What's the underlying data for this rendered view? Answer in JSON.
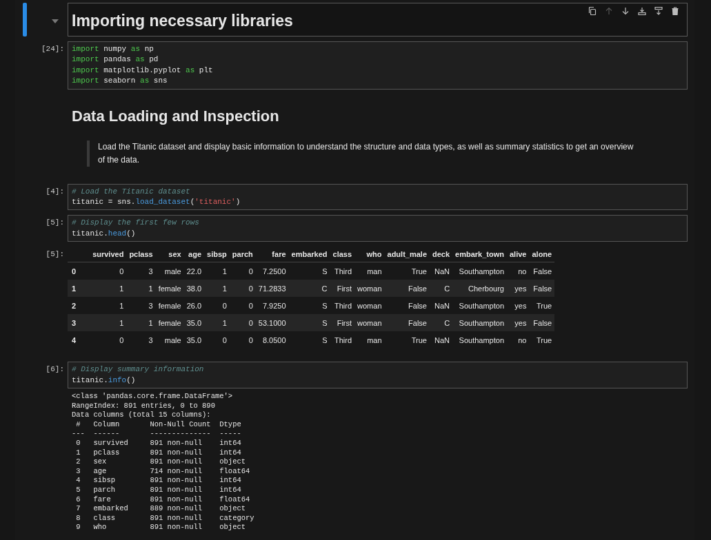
{
  "cells": [
    {
      "kind": "title",
      "active": true,
      "text": "Importing necessary libraries",
      "toolbar": [
        {
          "disabled": false
        },
        {
          "disabled": true
        },
        {
          "disabled": false
        },
        {
          "disabled": false
        },
        {
          "disabled": false
        },
        {
          "disabled": false
        }
      ]
    },
    {
      "kind": "code",
      "prompt": "[24]:",
      "lines": [
        [
          {
            "kind": "keyword",
            "text": "import"
          },
          {
            "kind": "plain",
            "text": " numpy "
          },
          {
            "kind": "keyword",
            "text": "as"
          },
          {
            "kind": "plain",
            "text": " np"
          }
        ],
        [
          {
            "kind": "keyword",
            "text": "import"
          },
          {
            "kind": "plain",
            "text": " pandas "
          },
          {
            "kind": "keyword",
            "text": "as"
          },
          {
            "kind": "plain",
            "text": " pd"
          }
        ],
        [
          {
            "kind": "keyword",
            "text": "import"
          },
          {
            "kind": "plain",
            "text": " matplotlib.pyplot "
          },
          {
            "kind": "keyword",
            "text": "as"
          },
          {
            "kind": "plain",
            "text": " plt"
          }
        ],
        [
          {
            "kind": "keyword",
            "text": "import"
          },
          {
            "kind": "plain",
            "text": " seaborn "
          },
          {
            "kind": "keyword",
            "text": "as"
          },
          {
            "kind": "plain",
            "text": " sns"
          }
        ]
      ]
    },
    {
      "kind": "section",
      "text": "Data Loading and Inspection",
      "quote": "Load the Titanic dataset and display basic information to understand the structure and data types, as well as summary statistics to get an overview of the data."
    },
    {
      "kind": "code",
      "prompt": "[4]:",
      "lines": [
        [
          {
            "kind": "comment",
            "text": "# Load the Titanic dataset"
          }
        ],
        [
          {
            "kind": "plain",
            "text": "titanic = sns."
          },
          {
            "kind": "function",
            "text": "load_dataset"
          },
          {
            "kind": "plain",
            "text": "("
          },
          {
            "kind": "string",
            "text": "'titanic'"
          },
          {
            "kind": "plain",
            "text": ")"
          }
        ]
      ]
    },
    {
      "kind": "code",
      "prompt": "[5]:",
      "lines": [
        [
          {
            "kind": "comment",
            "text": "# Display the first few rows"
          }
        ],
        [
          {
            "kind": "plain",
            "text": "titanic."
          },
          {
            "kind": "function",
            "text": "head"
          },
          {
            "kind": "plain",
            "text": "()"
          }
        ]
      ],
      "output": {
        "kind": "table",
        "prompt": "[5]:",
        "columns": [
          "survived",
          "pclass",
          "sex",
          "age",
          "sibsp",
          "parch",
          "fare",
          "embarked",
          "class",
          "who",
          "adult_male",
          "deck",
          "embark_town",
          "alive",
          "alone"
        ],
        "rows": [
          {
            "index": "0",
            "cells": [
              "0",
              "3",
              "male",
              "22.0",
              "1",
              "0",
              "7.2500",
              "S",
              "Third",
              "man",
              "True",
              "NaN",
              "Southampton",
              "no",
              "False"
            ]
          },
          {
            "index": "1",
            "cells": [
              "1",
              "1",
              "female",
              "38.0",
              "1",
              "0",
              "71.2833",
              "C",
              "First",
              "woman",
              "False",
              "C",
              "Cherbourg",
              "yes",
              "False"
            ]
          },
          {
            "index": "2",
            "cells": [
              "1",
              "3",
              "female",
              "26.0",
              "0",
              "0",
              "7.9250",
              "S",
              "Third",
              "woman",
              "False",
              "NaN",
              "Southampton",
              "yes",
              "True"
            ]
          },
          {
            "index": "3",
            "cells": [
              "1",
              "1",
              "female",
              "35.0",
              "1",
              "0",
              "53.1000",
              "S",
              "First",
              "woman",
              "False",
              "C",
              "Southampton",
              "yes",
              "False"
            ]
          },
          {
            "index": "4",
            "cells": [
              "0",
              "3",
              "male",
              "35.0",
              "0",
              "0",
              "8.0500",
              "S",
              "Third",
              "man",
              "True",
              "NaN",
              "Southampton",
              "no",
              "True"
            ]
          }
        ]
      }
    },
    {
      "kind": "code",
      "prompt": "[6]:",
      "lines": [
        [
          {
            "kind": "comment",
            "text": "# Display summary information"
          }
        ],
        [
          {
            "kind": "plain",
            "text": "titanic."
          },
          {
            "kind": "function",
            "text": "info"
          },
          {
            "kind": "plain",
            "text": "()"
          }
        ]
      ],
      "output": {
        "kind": "text",
        "lines": [
          "<class 'pandas.core.frame.DataFrame'>",
          "RangeIndex: 891 entries, 0 to 890",
          "Data columns (total 15 columns):",
          " #   Column       Non-Null Count  Dtype   ",
          "---  ------       --------------  -----   ",
          " 0   survived     891 non-null    int64   ",
          " 1   pclass       891 non-null    int64   ",
          " 2   sex          891 non-null    object  ",
          " 3   age          714 non-null    float64 ",
          " 4   sibsp        891 non-null    int64   ",
          " 5   parch        891 non-null    int64   ",
          " 6   fare         891 non-null    float64 ",
          " 7   embarked     889 non-null    object  ",
          " 8   class        891 non-null    category",
          " 9   who          891 non-null    object  "
        ]
      }
    }
  ]
}
